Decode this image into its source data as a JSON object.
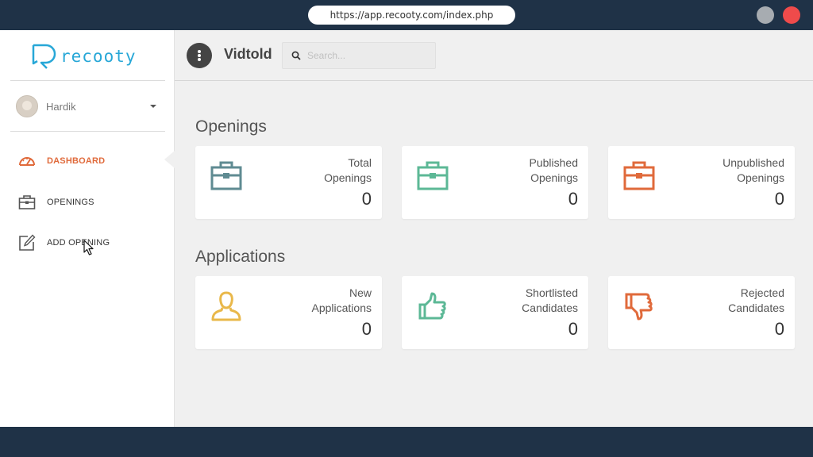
{
  "browser": {
    "url": "https://app.recooty.com/index.php"
  },
  "sidebar": {
    "logo_text": "recooty",
    "user_name": "Hardik",
    "items": [
      {
        "label": "DASHBOARD",
        "icon": "speedometer-icon",
        "active": true
      },
      {
        "label": "OPENINGS",
        "icon": "briefcase-icon",
        "active": false
      },
      {
        "label": "ADD OPENING",
        "icon": "edit-icon",
        "active": false
      }
    ]
  },
  "header": {
    "company": "Vidtold",
    "search_placeholder": "Search..."
  },
  "openings": {
    "title": "Openings",
    "cards": [
      {
        "label_line1": "Total",
        "label_line2": "Openings",
        "value": "0",
        "icon": "briefcase-icon",
        "color": "#5f8b92"
      },
      {
        "label_line1": "Published",
        "label_line2": "Openings",
        "value": "0",
        "icon": "briefcase-icon",
        "color": "#5cb896"
      },
      {
        "label_line1": "Unpublished",
        "label_line2": "Openings",
        "value": "0",
        "icon": "briefcase-icon",
        "color": "#e06a3b"
      }
    ]
  },
  "applications": {
    "title": "Applications",
    "cards": [
      {
        "label_line1": "New",
        "label_line2": "Applications",
        "value": "0",
        "icon": "user-icon",
        "color": "#e9b84a"
      },
      {
        "label_line1": "Shortlisted",
        "label_line2": "Candidates",
        "value": "0",
        "icon": "thumbs-up-icon",
        "color": "#5cb896"
      },
      {
        "label_line1": "Rejected",
        "label_line2": "Candidates",
        "value": "0",
        "icon": "thumbs-down-icon",
        "color": "#e06a3b"
      }
    ]
  },
  "colors": {
    "accent": "#27a7d7",
    "active_nav": "#e06a3b",
    "frame": "#1f3247"
  }
}
